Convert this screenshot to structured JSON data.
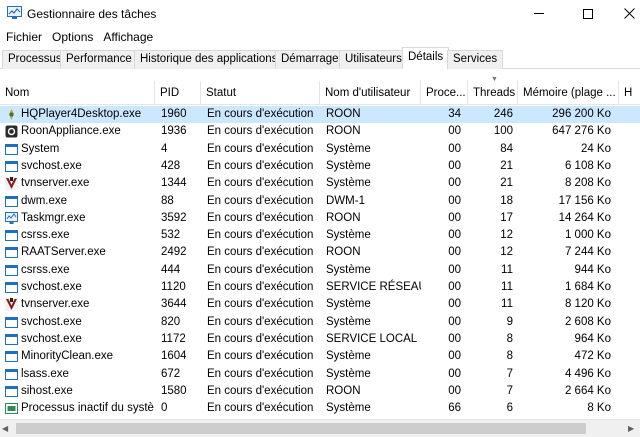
{
  "window": {
    "title": "Gestionnaire des tâches"
  },
  "menu": {
    "items": [
      "Fichier",
      "Options",
      "Affichage"
    ]
  },
  "tabs": [
    "Processus",
    "Performance",
    "Historique des applications",
    "Démarrage",
    "Utilisateurs",
    "Détails",
    "Services"
  ],
  "active_tab": "Détails",
  "columns": {
    "name": "Nom",
    "pid": "PID",
    "status": "Statut",
    "user": "Nom d'utilisateur",
    "cpu": "Proce...",
    "threads": "Threads",
    "memory": "Mémoire (plage ...",
    "extra": "H"
  },
  "rows": [
    {
      "icon": "hqplayer-icon",
      "name": "HQPlayer4Desktop.exe",
      "pid": "1960",
      "status": "En cours d'exécution",
      "user": "ROON",
      "cpu": "34",
      "threads": "246",
      "memory": "296 200 Ko",
      "selected": true
    },
    {
      "icon": "roon-icon",
      "name": "RoonAppliance.exe",
      "pid": "1936",
      "status": "En cours d'exécution",
      "user": "ROON",
      "cpu": "00",
      "threads": "100",
      "memory": "647 276 Ko"
    },
    {
      "icon": "window-icon",
      "name": "System",
      "pid": "4",
      "status": "En cours d'exécution",
      "user": "Système",
      "cpu": "00",
      "threads": "84",
      "memory": "24 Ko"
    },
    {
      "icon": "window-icon",
      "name": "svchost.exe",
      "pid": "428",
      "status": "En cours d'exécution",
      "user": "Système",
      "cpu": "00",
      "threads": "21",
      "memory": "6 108 Ko"
    },
    {
      "icon": "vnc-icon",
      "name": "tvnserver.exe",
      "pid": "1344",
      "status": "En cours d'exécution",
      "user": "Système",
      "cpu": "00",
      "threads": "21",
      "memory": "8 208 Ko"
    },
    {
      "icon": "window-icon",
      "name": "dwm.exe",
      "pid": "88",
      "status": "En cours d'exécution",
      "user": "DWM-1",
      "cpu": "00",
      "threads": "18",
      "memory": "17 156 Ko"
    },
    {
      "icon": "taskmgr-icon",
      "name": "Taskmgr.exe",
      "pid": "3592",
      "status": "En cours d'exécution",
      "user": "ROON",
      "cpu": "00",
      "threads": "17",
      "memory": "14 264 Ko"
    },
    {
      "icon": "window-icon",
      "name": "csrss.exe",
      "pid": "532",
      "status": "En cours d'exécution",
      "user": "Système",
      "cpu": "00",
      "threads": "12",
      "memory": "1 000 Ko"
    },
    {
      "icon": "window-icon",
      "name": "RAATServer.exe",
      "pid": "2492",
      "status": "En cours d'exécution",
      "user": "ROON",
      "cpu": "00",
      "threads": "12",
      "memory": "7 244 Ko"
    },
    {
      "icon": "window-icon",
      "name": "csrss.exe",
      "pid": "444",
      "status": "En cours d'exécution",
      "user": "Système",
      "cpu": "00",
      "threads": "11",
      "memory": "944 Ko"
    },
    {
      "icon": "window-icon",
      "name": "svchost.exe",
      "pid": "1120",
      "status": "En cours d'exécution",
      "user": "SERVICE RÉSEAU",
      "cpu": "00",
      "threads": "11",
      "memory": "1 684 Ko"
    },
    {
      "icon": "vnc-icon",
      "name": "tvnserver.exe",
      "pid": "3644",
      "status": "En cours d'exécution",
      "user": "Système",
      "cpu": "00",
      "threads": "11",
      "memory": "8 120 Ko"
    },
    {
      "icon": "window-icon",
      "name": "svchost.exe",
      "pid": "820",
      "status": "En cours d'exécution",
      "user": "Système",
      "cpu": "00",
      "threads": "9",
      "memory": "2 608 Ko"
    },
    {
      "icon": "window-icon",
      "name": "svchost.exe",
      "pid": "1172",
      "status": "En cours d'exécution",
      "user": "SERVICE LOCAL",
      "cpu": "00",
      "threads": "8",
      "memory": "964 Ko"
    },
    {
      "icon": "window-icon",
      "name": "MinorityClean.exe",
      "pid": "1604",
      "status": "En cours d'exécution",
      "user": "Système",
      "cpu": "00",
      "threads": "8",
      "memory": "472 Ko"
    },
    {
      "icon": "window-icon",
      "name": "lsass.exe",
      "pid": "672",
      "status": "En cours d'exécution",
      "user": "Système",
      "cpu": "00",
      "threads": "7",
      "memory": "4 496 Ko"
    },
    {
      "icon": "window-icon",
      "name": "sihost.exe",
      "pid": "1580",
      "status": "En cours d'exécution",
      "user": "ROON",
      "cpu": "00",
      "threads": "7",
      "memory": "2 664 Ko"
    },
    {
      "icon": "idle-icon",
      "name": "Processus inactif du systè...",
      "pid": "0",
      "status": "En cours d'exécution",
      "user": "Système",
      "cpu": "66",
      "threads": "6",
      "memory": "8 Ko"
    }
  ],
  "colors": {
    "selected_row": "#cce8ff",
    "icon_blue": "#1e6fc0",
    "border": "#d9d9d9"
  }
}
